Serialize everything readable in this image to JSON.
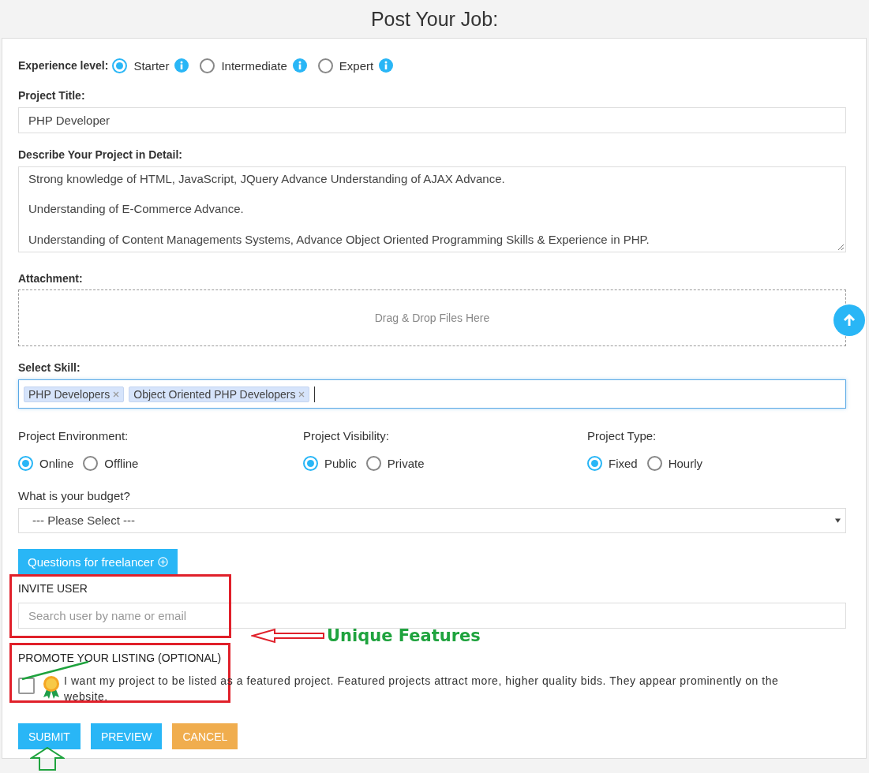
{
  "page_title": "Post Your Job:",
  "experience": {
    "label": "Experience level:",
    "options": [
      {
        "label": "Starter",
        "selected": true
      },
      {
        "label": "Intermediate",
        "selected": false
      },
      {
        "label": "Expert",
        "selected": false
      }
    ]
  },
  "project_title": {
    "label": "Project Title:",
    "value": "PHP Developer"
  },
  "description": {
    "label": "Describe Your Project in Detail:",
    "value": "Strong knowledge of HTML, JavaScript, JQuery Advance Understanding of AJAX Advance.\n\nUnderstanding of E-Commerce Advance.\n\nUnderstanding of Content Managements Systems, Advance Object Oriented Programming Skills & Experience in PHP."
  },
  "attachment": {
    "label": "Attachment:",
    "dropzone_text": "Drag & Drop Files Here"
  },
  "skills": {
    "label": "Select Skill:",
    "tags": [
      "PHP Developers",
      "Object Oriented PHP Developers"
    ]
  },
  "option_groups": [
    {
      "label": "Project Environment:",
      "options": [
        {
          "label": "Online",
          "selected": true
        },
        {
          "label": "Offline",
          "selected": false
        }
      ]
    },
    {
      "label": "Project Visibility:",
      "options": [
        {
          "label": "Public",
          "selected": true
        },
        {
          "label": "Private",
          "selected": false
        }
      ]
    },
    {
      "label": "Project Type:",
      "options": [
        {
          "label": "Fixed",
          "selected": true
        },
        {
          "label": "Hourly",
          "selected": false
        }
      ]
    }
  ],
  "budget": {
    "label": "What is your budget?",
    "value": "--- Please Select ---"
  },
  "questions_button": "Questions for freelancer",
  "invite": {
    "label": "INVITE USER",
    "placeholder": "Search user by name or email"
  },
  "promote": {
    "label": "PROMOTE YOUR LISTING (OPTIONAL)",
    "checked": false,
    "text": "I want my project to be listed as a featured project. Featured projects attract more, higher quality bids. They appear prominently on the website."
  },
  "buttons": [
    {
      "label": "SUBMIT",
      "kind": "primary"
    },
    {
      "label": "PREVIEW",
      "kind": "primary"
    },
    {
      "label": "CANCEL",
      "kind": "warning"
    }
  ],
  "annotation": {
    "text": "Unique Features"
  }
}
